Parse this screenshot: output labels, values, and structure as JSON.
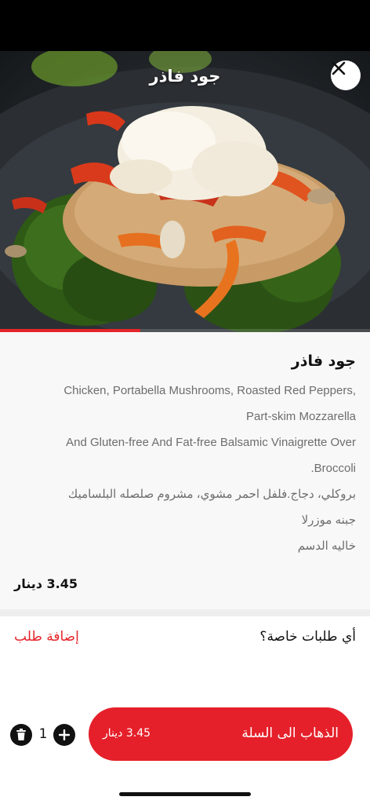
{
  "header": {
    "title": "جود فاذر",
    "close_icon": "close-icon"
  },
  "media": {
    "progress_fraction": 0.38,
    "accent_color": "#e5252a"
  },
  "item": {
    "name": "جود فاذر",
    "description_lines": [
      "Chicken, Portabella Mushrooms, Roasted Red Peppers,",
      "Part-skim Mozzarella",
      "And Gluten-free And Fat-free Balsamic Vinaigrette Over",
      ".Broccoli",
      "بروكلي، دجاج.فلفل احمر مشوي، مشروم صلصله البلساميك",
      "جبنه موزرلا",
      "خاليه الدسم"
    ],
    "price": "3.45 دينار"
  },
  "special_requests": {
    "label": "أي طلبات خاصة؟",
    "add_label": "إضافة طلب"
  },
  "cart": {
    "quantity": "1",
    "button_label": "الذهاب الى السلة",
    "button_price": "3.45 دينار",
    "button_color": "#e5202a",
    "trash_icon": "trash-icon",
    "plus_icon": "plus-icon"
  }
}
